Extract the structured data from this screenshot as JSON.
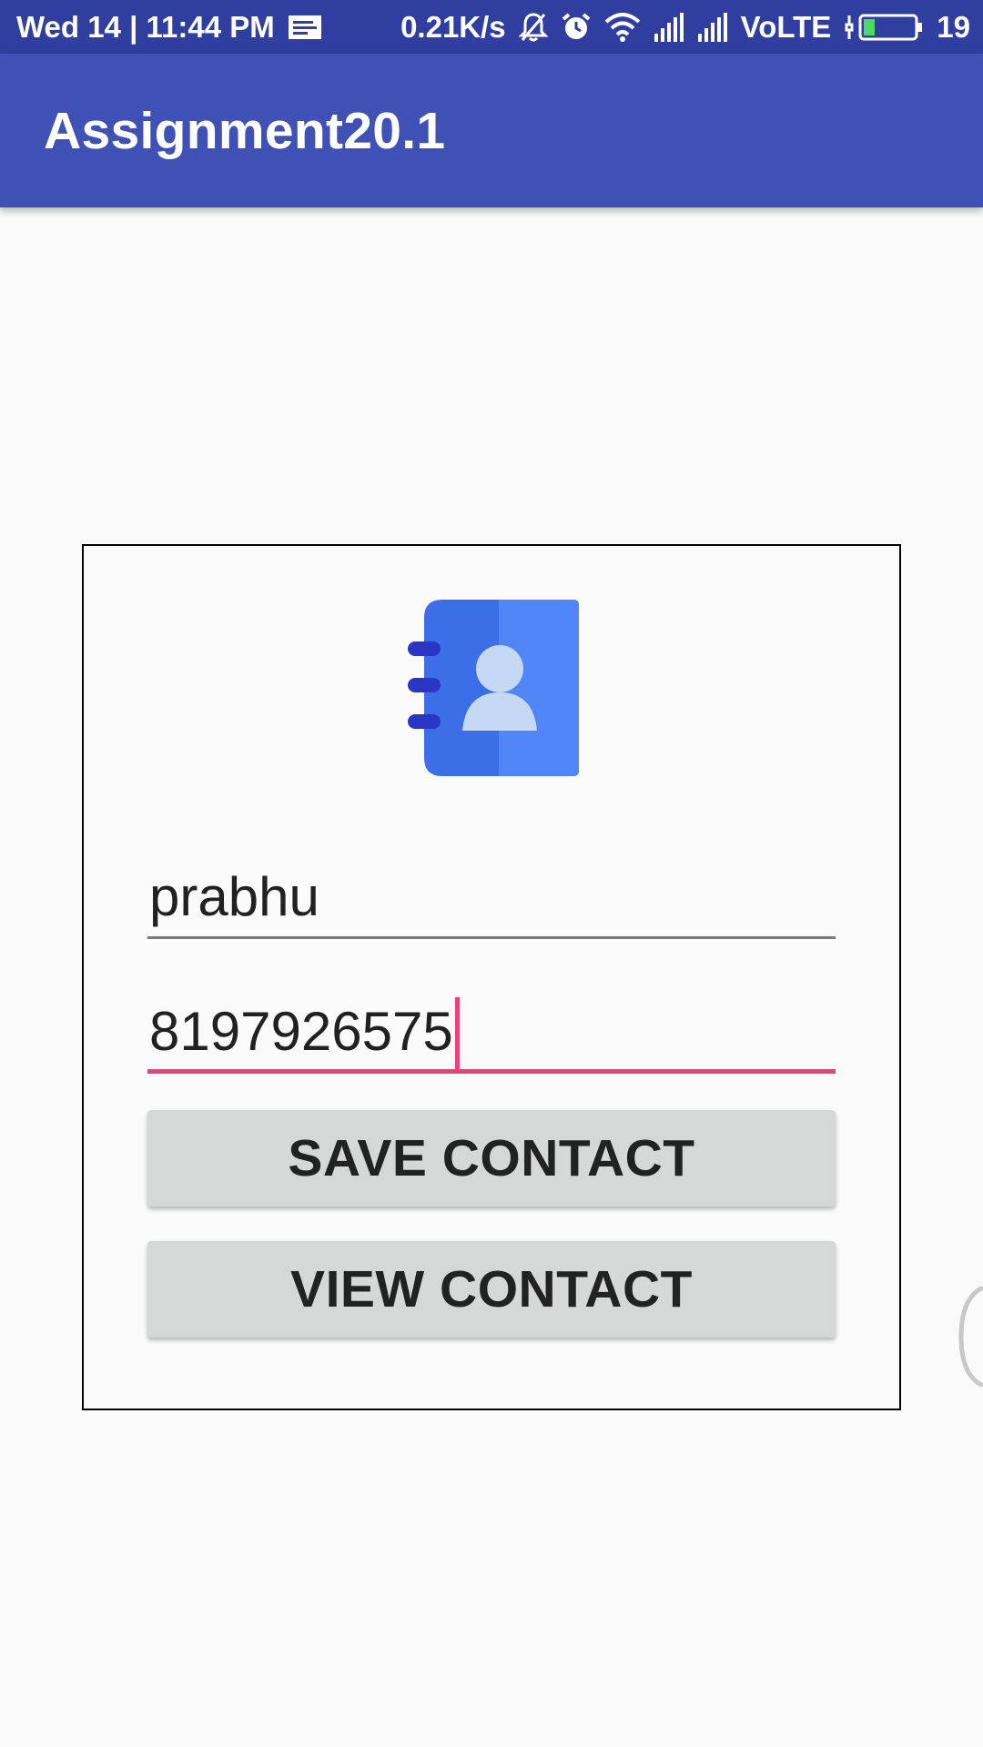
{
  "status_bar": {
    "datetime": "Wed 14 | 11:44 PM",
    "net_speed": "0.21K/s",
    "network_type": "VoLTE",
    "battery_level": "19",
    "icons": [
      "notification-message-icon",
      "mute-icon",
      "alarm-icon",
      "wifi-icon",
      "signal-icon",
      "signal-icon",
      "battery-icon"
    ]
  },
  "app_bar": {
    "title": "Assignment20.1"
  },
  "form": {
    "logo_icon": "contact-book-icon",
    "name_value": "prabhu",
    "phone_value": "8197926575",
    "save_label": "SAVE CONTACT",
    "view_label": "VIEW CONTACT"
  },
  "colors": {
    "status_bar": "#303f9f",
    "app_bar": "#3f51b5",
    "accent": "#ec407a",
    "button": "#d6d7d7",
    "background": "#fafafa"
  }
}
